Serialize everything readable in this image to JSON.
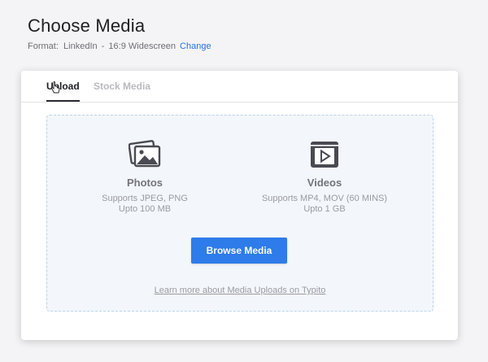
{
  "header": {
    "title": "Choose Media",
    "format_label": "Format:",
    "format_platform": "LinkedIn",
    "format_separator": "-",
    "format_ratio": "16:9 Widescreen",
    "change_link": "Change"
  },
  "tabs": [
    {
      "label": "Upload",
      "active": true
    },
    {
      "label": "Stock Media",
      "active": false
    }
  ],
  "upload": {
    "photos": {
      "icon": "photos-icon",
      "title": "Photos",
      "supports": "Supports JPEG, PNG",
      "limit": "Upto 100 MB"
    },
    "videos": {
      "icon": "video-play-icon",
      "title": "Videos",
      "supports": "Supports MP4, MOV (60 MINS)",
      "limit": "Upto 1 GB"
    },
    "browse_button": "Browse Media",
    "learn_more": "Learn more about Media Uploads on Typito"
  },
  "colors": {
    "accent": "#2e7bea",
    "link": "#2a72e5",
    "dropzone_bg": "#f3f7fb",
    "dropzone_border": "#bcd3e8"
  }
}
